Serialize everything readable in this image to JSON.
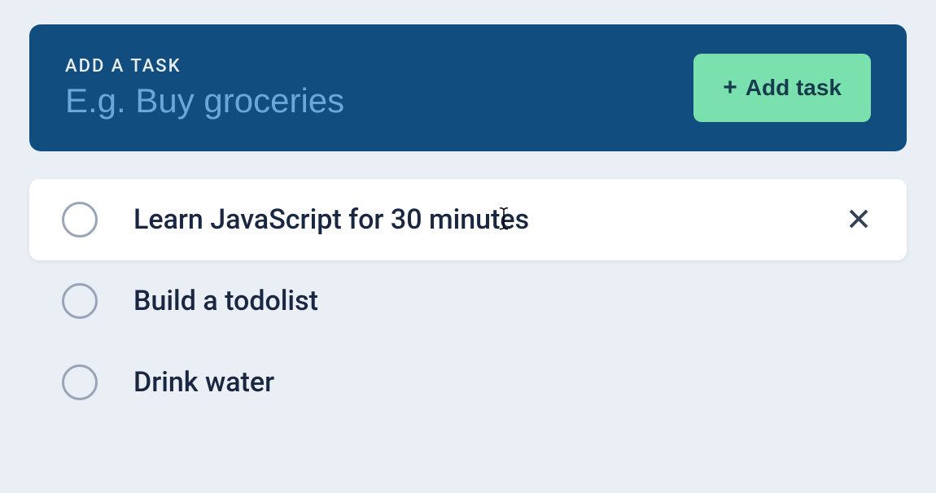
{
  "addTask": {
    "label": "Add a task",
    "placeholder": "E.g. Buy groceries",
    "value": "",
    "button_label": "Add task"
  },
  "tasks": [
    {
      "text": "Learn JavaScript for 30 minutes",
      "active": true
    },
    {
      "text": "Build a todolist",
      "active": false
    },
    {
      "text": "Drink water",
      "active": false
    }
  ]
}
